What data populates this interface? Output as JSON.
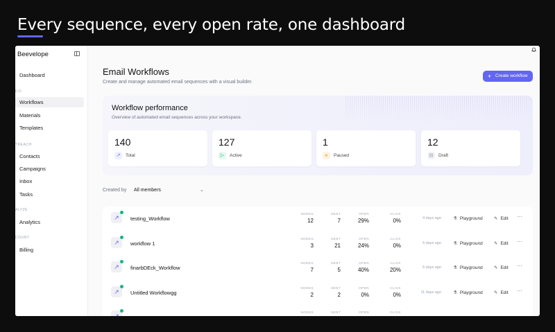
{
  "headline": "Every sequence, every open rate, one dashboard",
  "sidebar": {
    "brand": "Beevelope",
    "sections": [
      "ILD",
      "TREACH",
      "ALYZE",
      "COUNT"
    ],
    "items": [
      "Dashboard",
      "Workflows",
      "Materials",
      "Templates",
      "Contacts",
      "Campaigns",
      "Inbox",
      "Tasks",
      "Analytics",
      "Billing"
    ]
  },
  "header": {
    "title": "Email Workflows",
    "subtitle": "Create and manage automated email sequences with a visual builder.",
    "create_label": "Create workflow"
  },
  "performance": {
    "title": "Workflow performance",
    "subtitle": "Overview of automated email sequences across your workspace.",
    "stats": [
      {
        "value": "140",
        "label": "Total",
        "icon": "trend-icon",
        "color": "#6366f1"
      },
      {
        "value": "127",
        "label": "Active",
        "icon": "play-icon",
        "color": "#10b981"
      },
      {
        "value": "1",
        "label": "Paused",
        "icon": "pause-icon",
        "color": "#f59e0b"
      },
      {
        "value": "12",
        "label": "Draft",
        "icon": "document-icon",
        "color": "#9ca3af"
      }
    ]
  },
  "filter": {
    "label": "Created by",
    "value": "All members"
  },
  "columns": {
    "nodes": "NODES",
    "sent": "SENT",
    "open": "OPEN",
    "click": "CLICK"
  },
  "actions": {
    "playground": "Playground",
    "edit": "Edit",
    "more": "···"
  },
  "workflows": [
    {
      "name": "testing_Workflow",
      "nodes": "12",
      "sent": "7",
      "open": "29%",
      "click": "0%",
      "time": "4 days ago"
    },
    {
      "name": "workflow 1",
      "nodes": "3",
      "sent": "21",
      "open": "24%",
      "click": "0%",
      "time": "6 days ago"
    },
    {
      "name": "finarbDEck_Workflow",
      "nodes": "7",
      "sent": "5",
      "open": "40%",
      "click": "20%",
      "time": "6 days ago"
    },
    {
      "name": "Untitled Workflowgg",
      "nodes": "2",
      "sent": "2",
      "open": "0%",
      "click": "0%",
      "time": "11 days ago"
    }
  ]
}
